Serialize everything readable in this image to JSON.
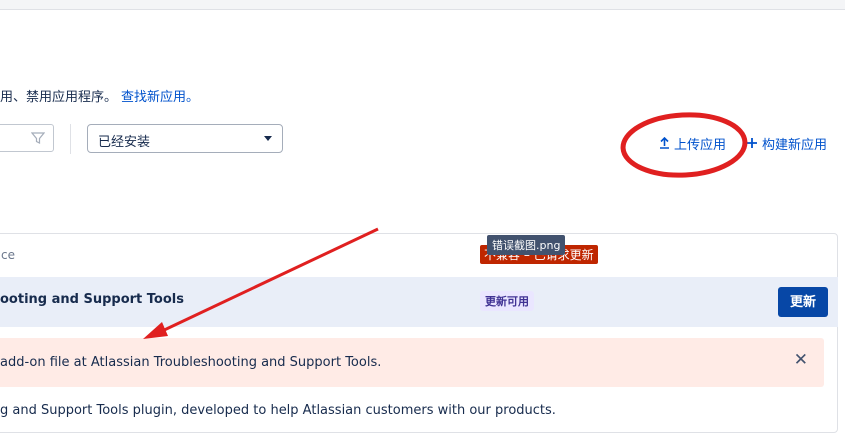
{
  "intro": {
    "text": "用、禁用应用程序。",
    "link": "查找新应用。"
  },
  "filters": {
    "status_select_value": "已经安装"
  },
  "actions": {
    "upload_label": "上传应用",
    "upload_icon": "upload-arrow",
    "build_label": "构建新应用",
    "build_icon": "plus"
  },
  "panel": {
    "header_text": "ce",
    "tooltip": "错误截图.png",
    "error_label": "不兼容 – 已请求更新"
  },
  "app": {
    "title": "ooting and Support Tools",
    "badge": "更新可用",
    "update_button": "更新"
  },
  "error": {
    "message": "add-on file at Atlassian Troubleshooting and Support Tools.",
    "close_icon": "close-x"
  },
  "description": "g and Support Tools plugin, developed to help Atlassian customers with our products.",
  "colors": {
    "link": "#0052cc",
    "primary_button": "#0747a6",
    "annotation_red": "#e02020",
    "error_bg": "#ffebe6",
    "row_highlight": "#e9eef8"
  }
}
